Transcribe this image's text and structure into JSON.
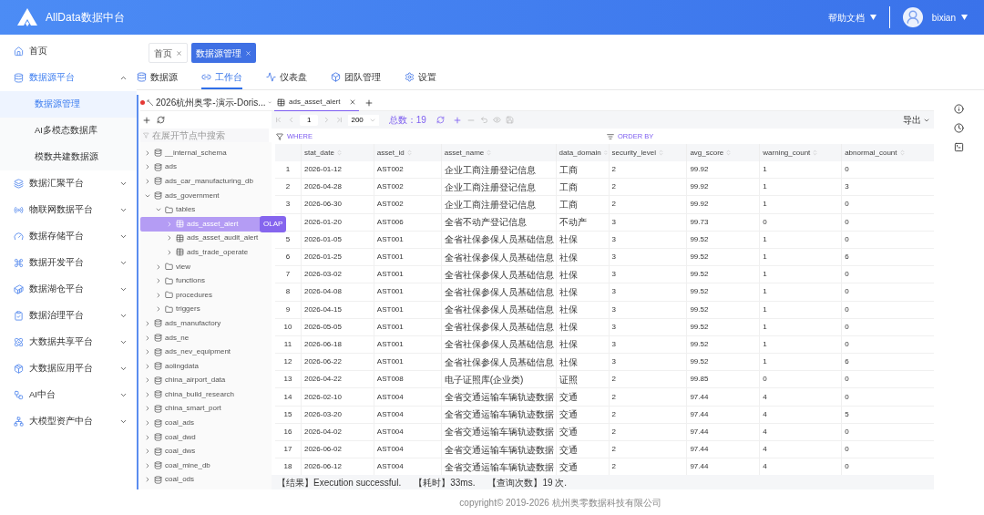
{
  "header": {
    "title": "AllData数据中台",
    "help": "帮助文档",
    "user": "bixian"
  },
  "sidebar": {
    "items": [
      {
        "label": "首页",
        "expanded": false,
        "selected": false
      },
      {
        "label": "数据源平台",
        "expanded": true,
        "selected": false,
        "children": [
          {
            "label": "数据源管理",
            "selected": true
          },
          {
            "label": "AI多模态数据库",
            "selected": false
          },
          {
            "label": "模数共建数据源",
            "selected": false
          }
        ]
      },
      {
        "label": "数据汇聚平台",
        "expanded": false,
        "selected": false
      },
      {
        "label": "物联网数据平台",
        "expanded": false,
        "selected": false
      },
      {
        "label": "数据存储平台",
        "expanded": false,
        "selected": false
      },
      {
        "label": "数据开发平台",
        "expanded": false,
        "selected": false
      },
      {
        "label": "数据湖仓平台",
        "expanded": false,
        "selected": false
      },
      {
        "label": "数据治理平台",
        "expanded": false,
        "selected": false
      },
      {
        "label": "大数据共享平台",
        "expanded": false,
        "selected": false
      },
      {
        "label": "大数据应用平台",
        "expanded": false,
        "selected": false
      },
      {
        "label": "AI中台",
        "expanded": false,
        "selected": false
      },
      {
        "label": "大模型资产中台",
        "expanded": false,
        "selected": false
      }
    ]
  },
  "page_tags": [
    {
      "label": "首页",
      "selected": false
    },
    {
      "label": "数据源管理",
      "selected": true
    }
  ],
  "nav_tabs": [
    {
      "label": "数据源",
      "selected": false
    },
    {
      "label": "工作台",
      "selected": true
    },
    {
      "label": "仪表盘",
      "selected": false
    },
    {
      "label": "团队管理",
      "selected": false
    },
    {
      "label": "设置",
      "selected": false
    }
  ],
  "connection": {
    "label": "2026杭州奥零-演示-Doris...",
    "color": "#e53935"
  },
  "editor_tabs": [
    {
      "label": "ads_asset_alert",
      "selected": true
    }
  ],
  "tree": {
    "placeholder": "在展开节点中搜索",
    "nodes": [
      {
        "kind": "database",
        "label": "__internal_schema",
        "expanded": false,
        "selected": false
      },
      {
        "kind": "database",
        "label": "ads",
        "expanded": false,
        "selected": false
      },
      {
        "kind": "database",
        "label": "ads_car_manufacturing_db",
        "expanded": false,
        "selected": false
      },
      {
        "kind": "database",
        "label": "ads_government",
        "expanded": true,
        "selected": false,
        "children": [
          {
            "kind": "folder",
            "label": "tables",
            "expanded": true,
            "selected": false,
            "children": [
              {
                "kind": "table",
                "label": "ads_asset_alert",
                "expanded": false,
                "selected": true
              },
              {
                "kind": "table",
                "label": "ads_asset_audit_alert",
                "expanded": false,
                "selected": false
              },
              {
                "kind": "table",
                "label": "ads_trade_operate",
                "expanded": false,
                "selected": false
              }
            ]
          },
          {
            "kind": "folder",
            "label": "view",
            "expanded": false,
            "selected": false
          },
          {
            "kind": "folder",
            "label": "functions",
            "expanded": false,
            "selected": false
          },
          {
            "kind": "folder",
            "label": "procedures",
            "expanded": false,
            "selected": false
          },
          {
            "kind": "folder",
            "label": "triggers",
            "expanded": false,
            "selected": false
          }
        ]
      },
      {
        "kind": "database",
        "label": "ads_manufactory",
        "expanded": false,
        "selected": false
      },
      {
        "kind": "database",
        "label": "ads_ne",
        "expanded": false,
        "selected": false
      },
      {
        "kind": "database",
        "label": "ads_nev_equipment",
        "expanded": false,
        "selected": false
      },
      {
        "kind": "database",
        "label": "aolingdata",
        "expanded": false,
        "selected": false
      },
      {
        "kind": "database",
        "label": "china_airport_data",
        "expanded": false,
        "selected": false
      },
      {
        "kind": "database",
        "label": "china_build_research",
        "expanded": false,
        "selected": false
      },
      {
        "kind": "database",
        "label": "china_smart_port",
        "expanded": false,
        "selected": false
      },
      {
        "kind": "database",
        "label": "coal_ads",
        "expanded": false,
        "selected": false
      },
      {
        "kind": "database",
        "label": "coal_dwd",
        "expanded": false,
        "selected": false
      },
      {
        "kind": "database",
        "label": "coal_dws",
        "expanded": false,
        "selected": false
      },
      {
        "kind": "database",
        "label": "coal_mine_db",
        "expanded": false,
        "selected": false
      },
      {
        "kind": "database",
        "label": "coal_ods",
        "expanded": false,
        "selected": false
      }
    ]
  },
  "tooltip": "OLAP",
  "toolbar": {
    "page": "1",
    "page_size": "200",
    "total": "总数：19",
    "export": "导出"
  },
  "filters": {
    "where": "WHERE",
    "order_by": "ORDER BY"
  },
  "table": {
    "columns": [
      "stat_date",
      "asset_id",
      "asset_name",
      "data_domain",
      "security_level",
      "avg_score",
      "warning_count",
      "abnormal_count"
    ],
    "rows": [
      {
        "index": "1",
        "cells": [
          "2026-01-12",
          "AST002",
          "企业工商注册登记信息",
          "工商",
          "2",
          "99.92",
          "1",
          "0"
        ]
      },
      {
        "index": "2",
        "cells": [
          "2026-04-28",
          "AST002",
          "企业工商注册登记信息",
          "工商",
          "2",
          "99.92",
          "1",
          "3"
        ]
      },
      {
        "index": "3",
        "cells": [
          "2026-06-30",
          "AST002",
          "企业工商注册登记信息",
          "工商",
          "2",
          "99.92",
          "1",
          "0"
        ]
      },
      {
        "cells": [
          "2026-01-20",
          "AST006",
          "全省不动产登记信息",
          "不动产",
          "3",
          "99.73",
          "0",
          "0"
        ]
      },
      {
        "index": "5",
        "cells": [
          "2026-01-05",
          "AST001",
          "全省社保参保人员基础信息",
          "社保",
          "3",
          "99.52",
          "1",
          "0"
        ]
      },
      {
        "index": "6",
        "cells": [
          "2026-01-25",
          "AST001",
          "全省社保参保人员基础信息",
          "社保",
          "3",
          "99.52",
          "1",
          "6"
        ]
      },
      {
        "index": "7",
        "cells": [
          "2026-03-02",
          "AST001",
          "全省社保参保人员基础信息",
          "社保",
          "3",
          "99.52",
          "1",
          "0"
        ]
      },
      {
        "index": "8",
        "cells": [
          "2026-04-08",
          "AST001",
          "全省社保参保人员基础信息",
          "社保",
          "3",
          "99.52",
          "1",
          "0"
        ]
      },
      {
        "index": "9",
        "cells": [
          "2026-04-15",
          "AST001",
          "全省社保参保人员基础信息",
          "社保",
          "3",
          "99.52",
          "1",
          "0"
        ]
      },
      {
        "index": "10",
        "cells": [
          "2026-05-05",
          "AST001",
          "全省社保参保人员基础信息",
          "社保",
          "3",
          "99.52",
          "1",
          "0"
        ]
      },
      {
        "index": "11",
        "cells": [
          "2026-06-18",
          "AST001",
          "全省社保参保人员基础信息",
          "社保",
          "3",
          "99.52",
          "1",
          "0"
        ]
      },
      {
        "index": "12",
        "cells": [
          "2026-06-22",
          "AST001",
          "全省社保参保人员基础信息",
          "社保",
          "3",
          "99.52",
          "1",
          "6"
        ]
      },
      {
        "index": "13",
        "cells": [
          "2026-04-22",
          "AST008",
          "电子证照库(企业类)",
          "证照",
          "2",
          "99.85",
          "0",
          "0"
        ]
      },
      {
        "index": "14",
        "cells": [
          "2026-02-10",
          "AST004",
          "全省交通运输车辆轨迹数据",
          "交通",
          "2",
          "97.44",
          "4",
          "0"
        ]
      },
      {
        "index": "15",
        "cells": [
          "2026-03-20",
          "AST004",
          "全省交通运输车辆轨迹数据",
          "交通",
          "2",
          "97.44",
          "4",
          "5"
        ]
      },
      {
        "index": "16",
        "cells": [
          "2026-04-02",
          "AST004",
          "全省交通运输车辆轨迹数据",
          "交通",
          "2",
          "97.44",
          "4",
          "0"
        ]
      },
      {
        "index": "17",
        "cells": [
          "2026-06-02",
          "AST004",
          "全省交通运输车辆轨迹数据",
          "交通",
          "2",
          "97.44",
          "4",
          "0"
        ]
      },
      {
        "index": "18",
        "cells": [
          "2026-06-12",
          "AST004",
          "全省交通运输车辆轨迹数据",
          "交通",
          "2",
          "97.44",
          "4",
          "0"
        ]
      }
    ]
  },
  "status": [
    "【结果】Execution successful.",
    "【耗时】33ms.",
    "【查询次数】19 次."
  ],
  "footer": "copyright© 2019-2026 杭州奥零数据科技有限公司"
}
